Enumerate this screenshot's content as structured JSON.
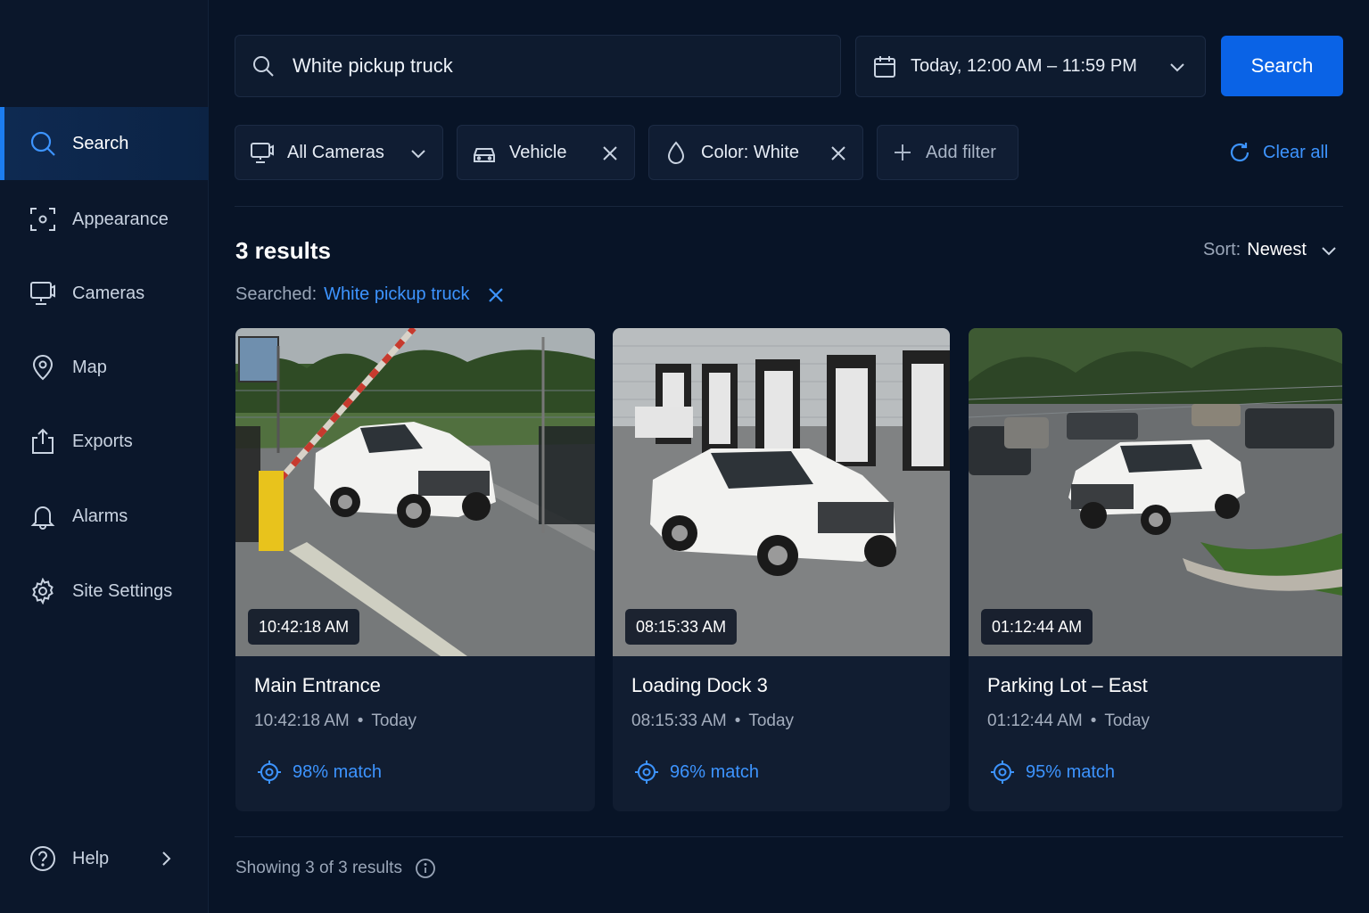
{
  "sidebar": {
    "items": [
      {
        "label": "Search",
        "icon": "search-icon",
        "active": true
      },
      {
        "label": "Appearance",
        "icon": "appearance-icon"
      },
      {
        "label": "Cameras",
        "icon": "camera-icon"
      },
      {
        "label": "Map",
        "icon": "map-pin-icon"
      },
      {
        "label": "Exports",
        "icon": "export-icon"
      },
      {
        "label": "Alarms",
        "icon": "bell-icon"
      },
      {
        "label": "Site Settings",
        "icon": "gear-icon"
      }
    ],
    "help_label": "Help"
  },
  "search": {
    "value": "White pickup truck",
    "button_label": "Search"
  },
  "date_range": {
    "label": "Today, 12:00 AM – 11:59 PM"
  },
  "filters": {
    "cameras": "All Cameras",
    "object_type": "Vehicle",
    "color": "Color: White",
    "add_filter": "Add filter",
    "clear_all": "Clear all"
  },
  "results": {
    "count_label": "3 results",
    "sort_label": "Sort:",
    "sort_value": "Newest",
    "searched_label": "Searched:",
    "searched_query": "White pickup truck",
    "items": [
      {
        "camera": "Main Entrance",
        "time": "10:42:18 AM",
        "day": "Today",
        "match": "98% match"
      },
      {
        "camera": "Loading Dock 3",
        "time": "08:15:33 AM",
        "day": "Today",
        "match": "96% match"
      },
      {
        "camera": "Parking Lot – East",
        "time": "01:12:44 AM",
        "day": "Today",
        "match": "95% match"
      }
    ],
    "footer": "Showing 3 of 3 results"
  },
  "colors": {
    "background": "#081427",
    "sidebar": "#0b172b",
    "accent": "#0a63e6",
    "link": "#3d94ff"
  }
}
